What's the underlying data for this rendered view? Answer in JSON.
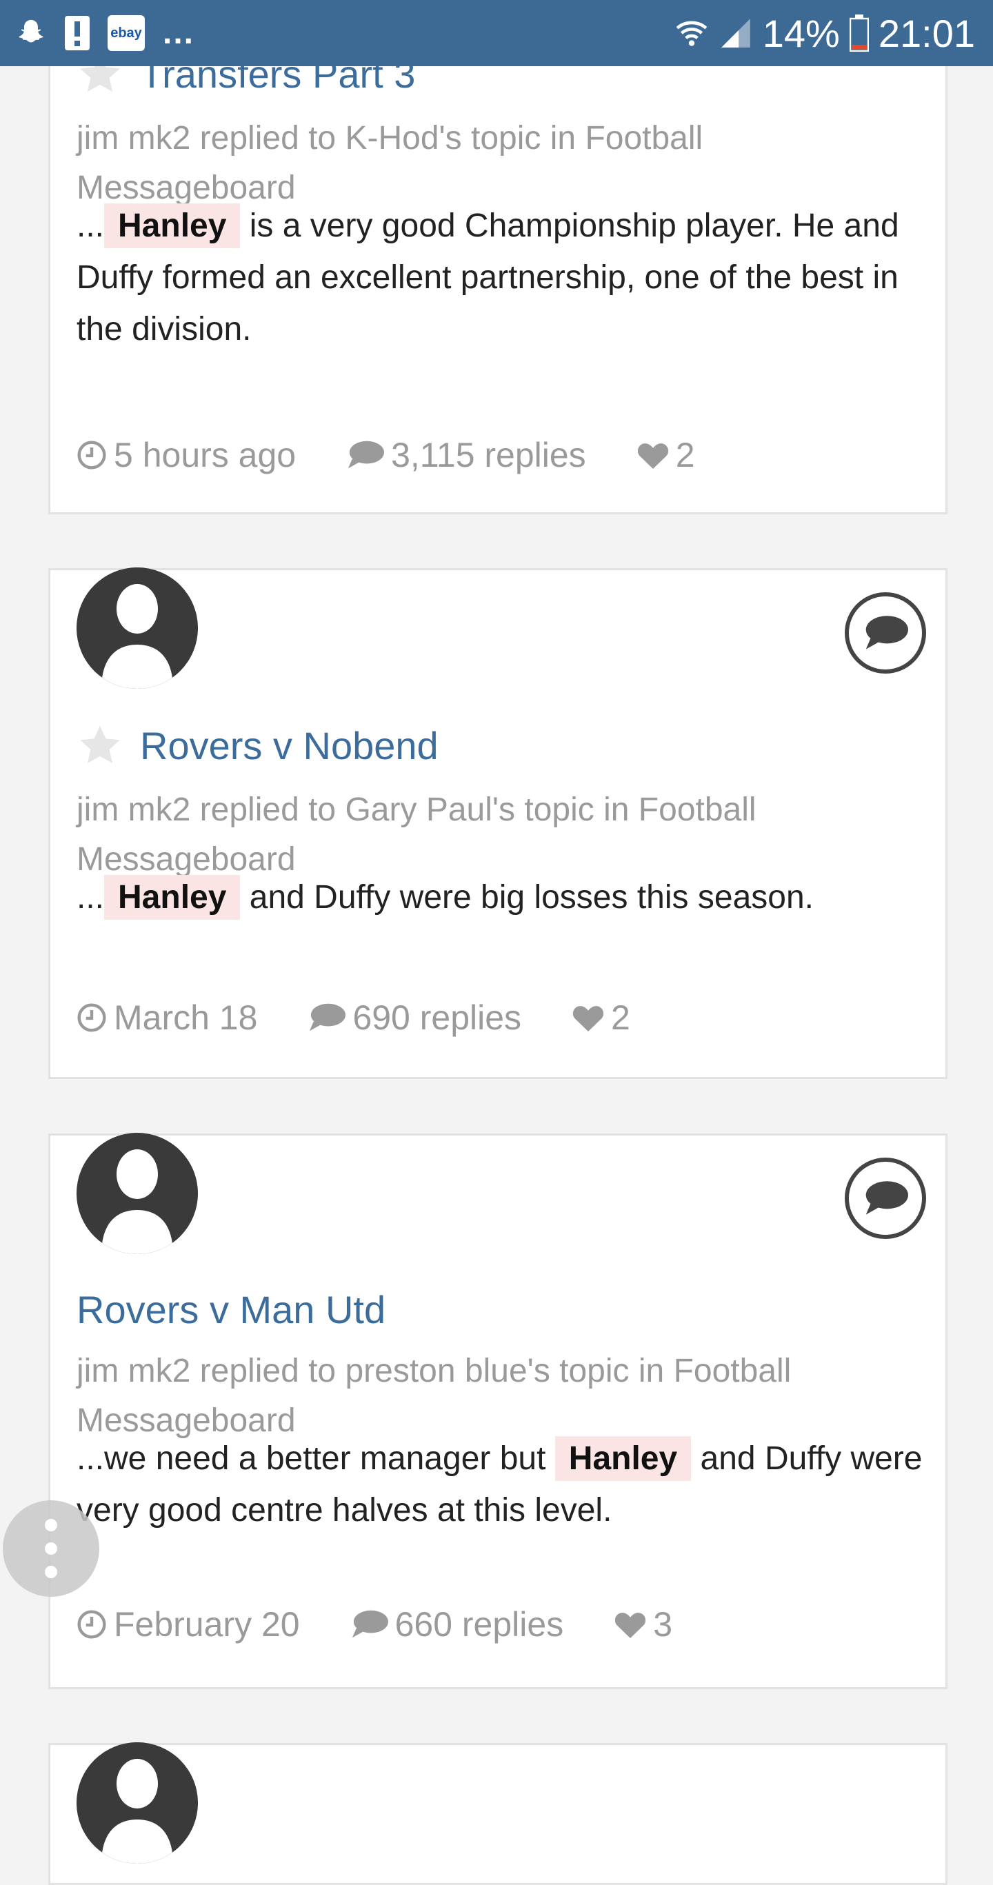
{
  "status_bar": {
    "ebay_label": "ebay",
    "more": "...",
    "battery": "14%",
    "time": "21:01"
  },
  "posts": [
    {
      "title": "Transfers Part 3",
      "meta": "jim mk2 replied to K-Hod's topic in Football Messageboard",
      "excerpt_prefix": "...",
      "highlight": "Hanley",
      "excerpt_suffix": " is a very good Championship player. He and Duffy formed an excellent partnership, one of the best in the division.",
      "time": "5 hours ago",
      "replies": "3,115 replies",
      "likes": "2"
    },
    {
      "title": "Rovers v Nobend",
      "meta": "jim mk2 replied to Gary Paul's topic in Football Messageboard",
      "excerpt_prefix": "...",
      "highlight": "Hanley",
      "excerpt_suffix": " and Duffy were big losses this season.",
      "time": "March 18",
      "replies": "690 replies",
      "likes": "2"
    },
    {
      "title": "Rovers v Man Utd",
      "meta": "jim mk2 replied to preston blue's topic in Football Messageboard",
      "excerpt_prefix": "...we need a better manager but ",
      "highlight": "Hanley",
      "excerpt_suffix": " and Duffy were very good centre halves at this level.",
      "time": "February 20",
      "replies": "660 replies",
      "likes": "3"
    }
  ],
  "icons": {
    "clock": "clock-icon",
    "replies": "speech-bubble-icon",
    "likes": "heart-icon",
    "star": "star-icon",
    "chat": "chat-bubble-icon",
    "menu": "vertical-dots-icon"
  }
}
